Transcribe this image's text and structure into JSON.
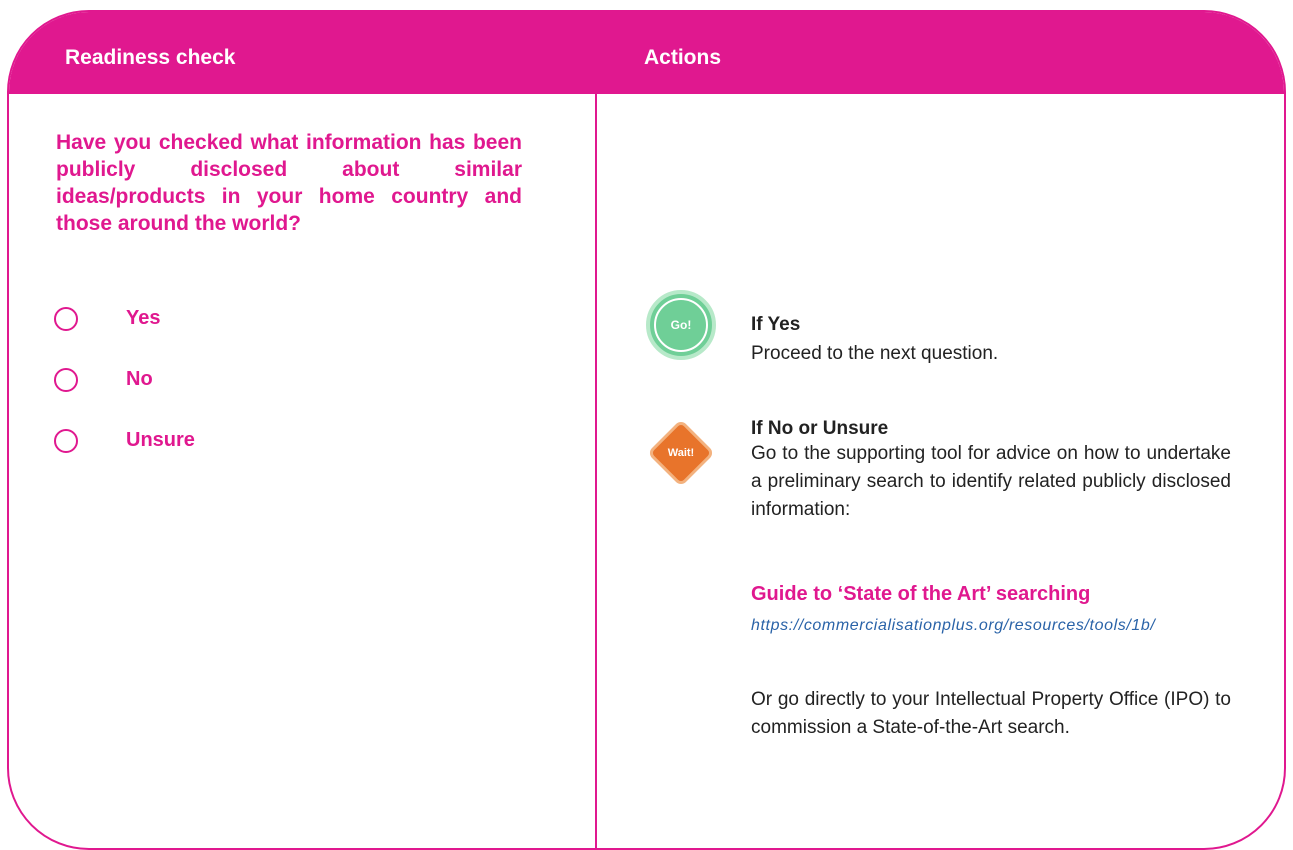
{
  "header": {
    "left_title": "Readiness check",
    "right_title": "Actions"
  },
  "question": "Have you checked what information has been publicly disclosed about similar ideas/products in your home country and those around the world?",
  "options": [
    {
      "label": "Yes"
    },
    {
      "label": "No"
    },
    {
      "label": "Unsure"
    }
  ],
  "actions": {
    "yes": {
      "badge": "Go!",
      "title": "If Yes",
      "text": "Proceed to the next question."
    },
    "no": {
      "badge": "Wait!",
      "title": "If No or Unsure",
      "text": "Go to the supporting tool for advice on how to undertake a preliminary search to identify related publicly disclosed information:",
      "link_title": "Guide to ‘State of the Art’ searching",
      "link_url": "https://commercialisationplus.org/resources/tools/1b/",
      "followup": "Or go directly to your Intellectual Property Office (IPO) to commission a State-of-the-Art search."
    }
  },
  "colors": {
    "accent": "#e0188f",
    "go": "#6fcf97",
    "wait": "#e8742b",
    "link": "#2a63a8"
  }
}
